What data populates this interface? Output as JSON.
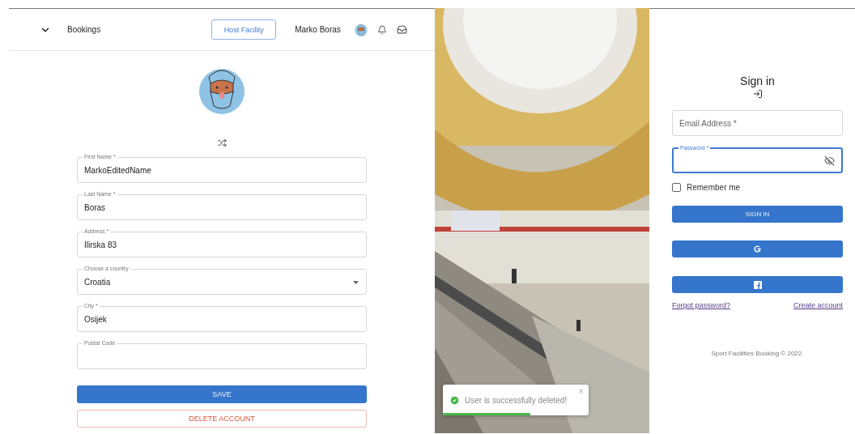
{
  "header": {
    "nav_label": "Bookings",
    "host_button": "Host Facility",
    "user_name": "Marko Boras"
  },
  "profile_form": {
    "fields": [
      {
        "kind": "text",
        "label": "First Name *",
        "value": "MarkoEditedName"
      },
      {
        "kind": "text",
        "label": "Last Name *",
        "value": "Boras"
      },
      {
        "kind": "text",
        "label": "Address *",
        "value": "Ilirska 83"
      },
      {
        "kind": "select",
        "label": "Choose a country",
        "value": "Croatia"
      },
      {
        "kind": "text",
        "label": "City *",
        "value": "Osijek"
      },
      {
        "kind": "text",
        "label": "Postal Code"
      }
    ],
    "save_button": "SAVE",
    "delete_button": "DELETE ACCOUNT"
  },
  "toast": {
    "message": "User is successfully deleted!",
    "close": "×",
    "level": 0.6
  },
  "sign_in": {
    "title": "Sign in",
    "email": {
      "placeholder": "Email Address *",
      "focused": false
    },
    "password": {
      "label": "Password *",
      "focused": true
    },
    "remember": {
      "label": "Remember me",
      "checked": false
    },
    "sign_in_button": "SIGN IN",
    "forgot_link": "Forgot password?",
    "create_link": "Create account",
    "footer": "Sport Facilities Booking © 2022."
  }
}
